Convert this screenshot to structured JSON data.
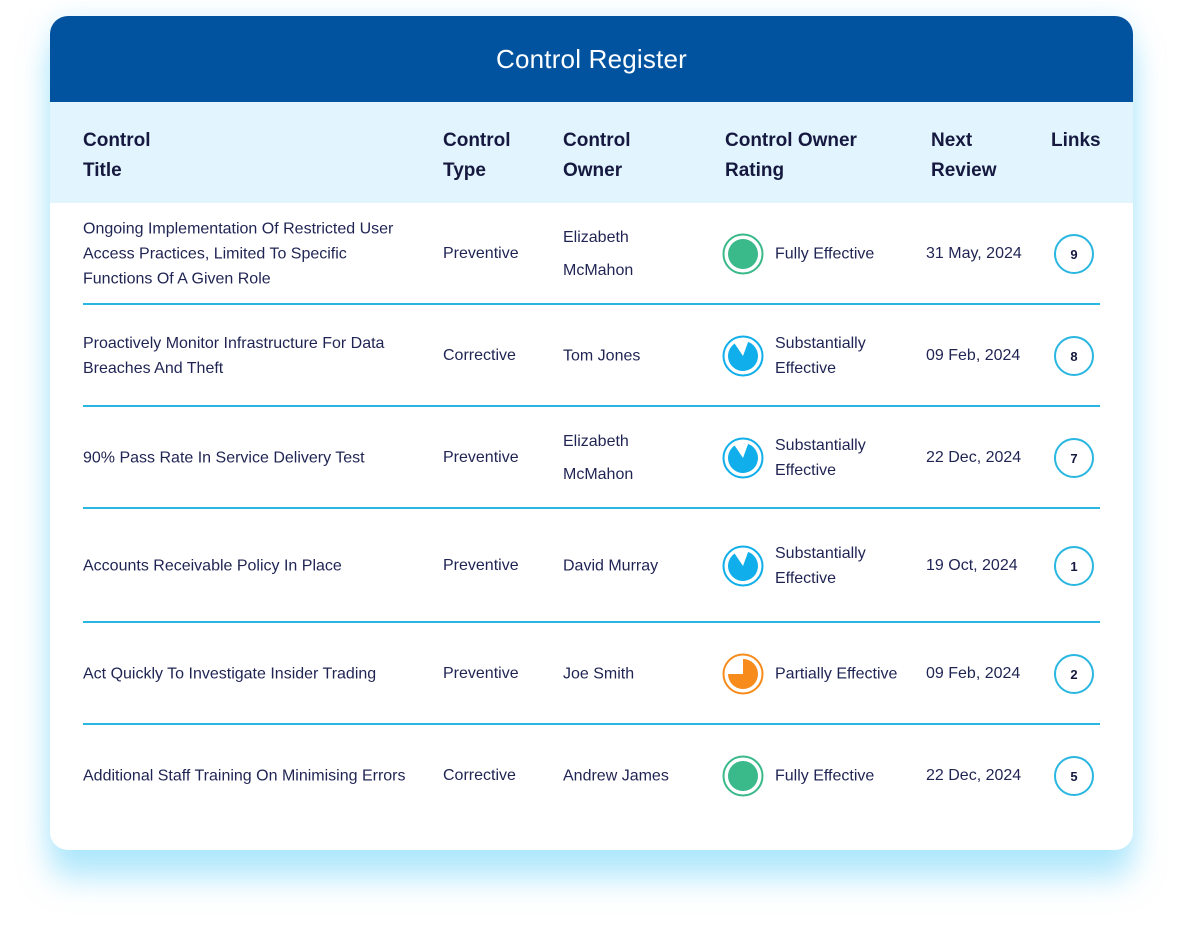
{
  "title": "Control Register",
  "columns": {
    "title": [
      "Control",
      "Title"
    ],
    "type": [
      "Control",
      "Type"
    ],
    "owner": [
      "Control",
      "Owner"
    ],
    "rating": [
      "Control Owner",
      "Rating"
    ],
    "review": [
      "Next",
      "Review"
    ],
    "links": [
      "Links"
    ]
  },
  "rating_levels": {
    "fully": {
      "label": "Fully Effective",
      "icon": "full-circle-icon",
      "color": "#3ab98a",
      "fraction": 1.0
    },
    "substantially": {
      "label": "Substantially Effective",
      "icon": "pie-three-quarter-icon",
      "color": "#10aeea",
      "fraction": 0.85
    },
    "partially": {
      "label": "Partially Effective",
      "icon": "pie-three-quarter-icon",
      "color": "#f78c1c",
      "fraction": 0.75
    }
  },
  "rows": [
    {
      "title": "Ongoing Implementation Of Restricted User Access Practices, Limited To Specific Functions Of A Given Role",
      "type": "Preventive",
      "owner": "Elizabeth McMahon",
      "rating": "Fully Effective",
      "rating_level": "fully",
      "review": "31 May, 2024",
      "links": "9"
    },
    {
      "title": "Proactively Monitor Infrastructure For Data Breaches And Theft",
      "type": "Corrective",
      "owner": "Tom Jones",
      "rating": "Substantially Effective",
      "rating_level": "substantially",
      "review": "09 Feb, 2024",
      "links": "8"
    },
    {
      "title": "90% Pass Rate In Service Delivery Test",
      "type": "Preventive",
      "owner": "Elizabeth McMahon",
      "rating": "Substantially Effective",
      "rating_level": "substantially",
      "review": "22 Dec, 2024",
      "links": "7"
    },
    {
      "title": "Accounts Receivable Policy In Place",
      "type": "Preventive",
      "owner": "David Murray",
      "rating": "Substantially Effective",
      "rating_level": "substantially",
      "review": "19 Oct, 2024",
      "links": "1"
    },
    {
      "title": "Act Quickly To Investigate Insider Trading",
      "type": "Preventive",
      "owner": "Joe Smith",
      "rating": "Partially Effective",
      "rating_level": "partially",
      "review": "09 Feb, 2024",
      "links": "2"
    },
    {
      "title": "Additional Staff Training On Minimising Errors",
      "type": "Corrective",
      "owner": "Andrew James",
      "rating": "Fully Effective",
      "rating_level": "fully",
      "review": "22 Dec, 2024",
      "links": "5"
    }
  ]
}
